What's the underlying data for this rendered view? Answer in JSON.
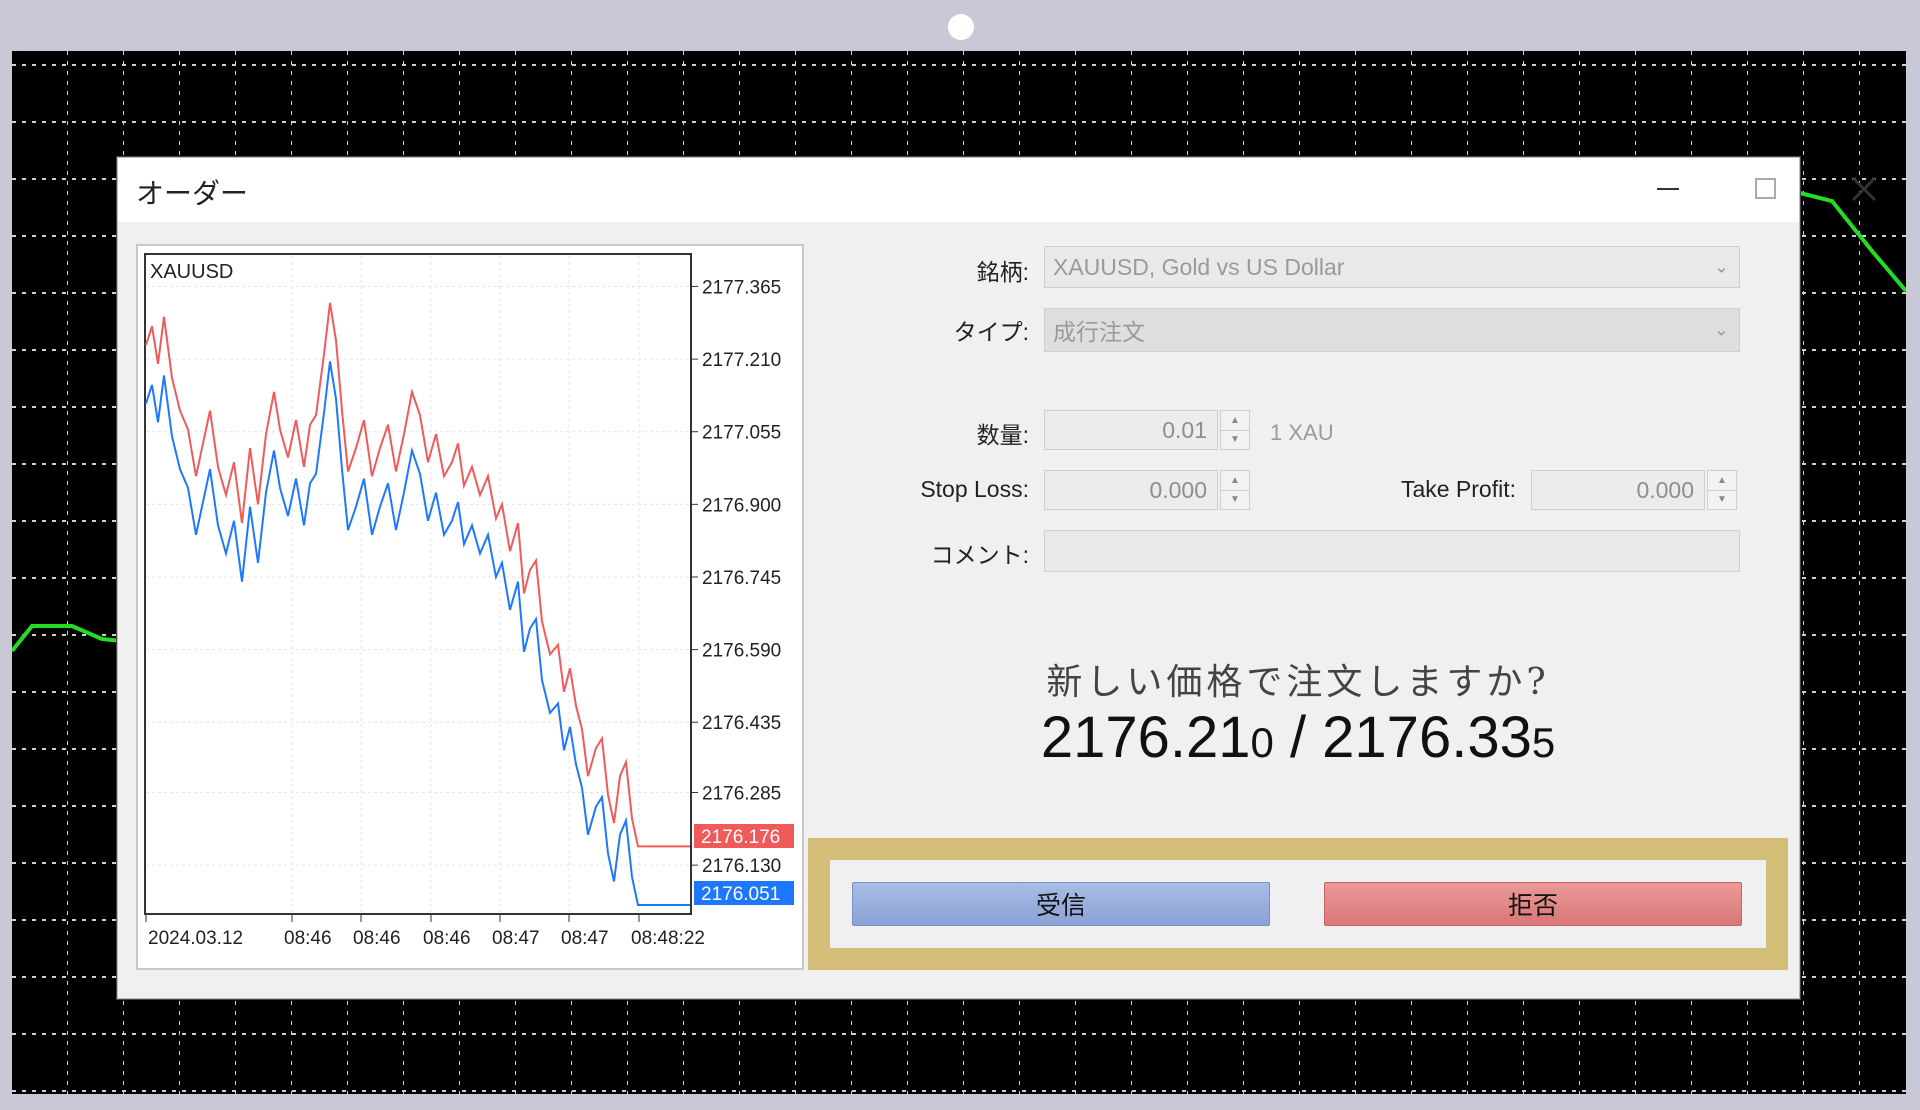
{
  "window": {
    "title": "オーダー",
    "minimize": "—",
    "maximize": "☐",
    "close": "✕"
  },
  "chart": {
    "symbol": "XAUUSD",
    "price_ticks": [
      "2177.365",
      "2177.210",
      "2177.055",
      "2176.900",
      "2176.745",
      "2176.590",
      "2176.435",
      "2176.285",
      "2176.130"
    ],
    "ask_tag": "2176.176",
    "bid_tag": "2176.051",
    "time_ticks": [
      "2024.03.12",
      "08:46",
      "08:46",
      "08:46",
      "08:47",
      "08:47",
      "08:48:22"
    ],
    "colors": {
      "ask": "#f05a5a",
      "bid": "#1e78ff",
      "ask_tag_bg": "#f05a5a",
      "bid_tag_bg": "#1e78ff"
    }
  },
  "form": {
    "symbol_label": "銘柄:",
    "symbol_value": "XAUUSD, Gold vs US Dollar",
    "type_label": "タイプ:",
    "type_value": "成行注文",
    "volume_label": "数量:",
    "volume_value": "0.01",
    "volume_unit": "1 XAU",
    "sl_label": "Stop Loss:",
    "sl_value": "0.000",
    "tp_label": "Take Profit:",
    "tp_value": "0.000",
    "comment_label": "コメント:",
    "comment_value": ""
  },
  "requote": {
    "question": "新しい価格で注文しますか?",
    "bid_main": "2176.21",
    "bid_small": "0",
    "separator": " / ",
    "ask_main": "2176.33",
    "ask_small": "5"
  },
  "buttons": {
    "accept": "受信",
    "reject": "拒否"
  },
  "accent": {
    "highlight_border": "#d4bd78",
    "bg_line": "#22dd22"
  }
}
